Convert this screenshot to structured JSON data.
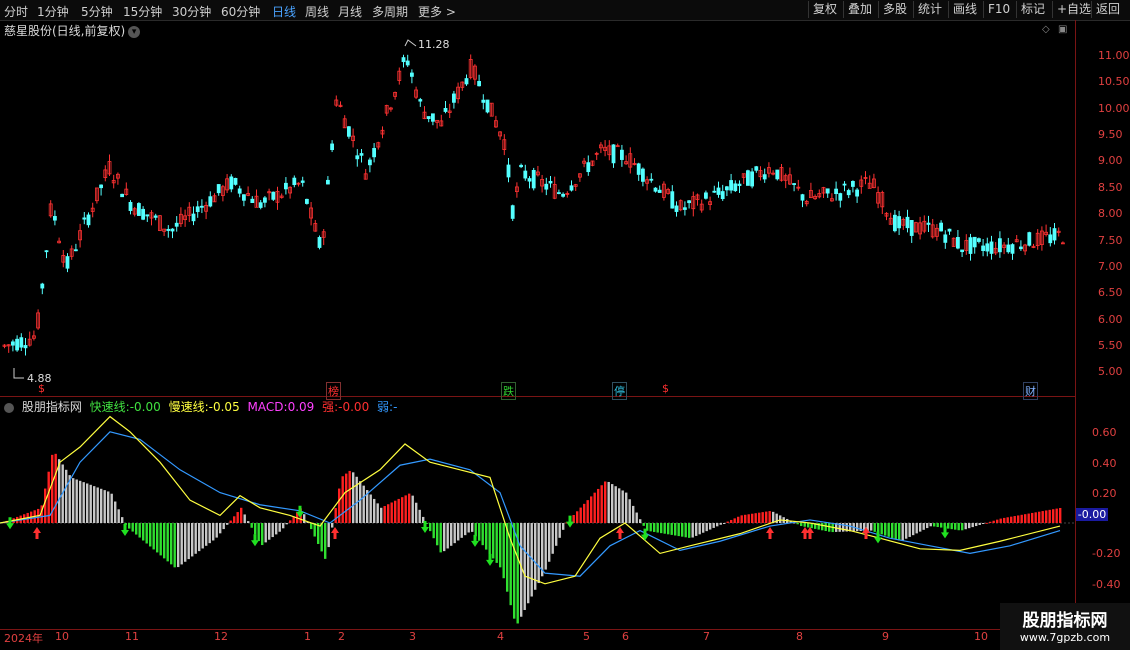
{
  "toolbar": {
    "timeframes": [
      "分时",
      "1分钟",
      "5分钟",
      "15分钟",
      "30分钟",
      "60分钟",
      "日线",
      "周线",
      "月线",
      "多周期",
      "更多 >"
    ],
    "active_timeframe": "日线",
    "right_buttons": [
      "复权",
      "叠加",
      "多股",
      "统计",
      "画线",
      "F10",
      "标记",
      "+自选",
      "返回"
    ]
  },
  "chart_header": {
    "title": "慈星股份(日线,前复权)"
  },
  "price_axis": [
    "11.00",
    "10.50",
    "10.00",
    "9.50",
    "9.00",
    "8.50",
    "8.00",
    "7.50",
    "7.00",
    "6.50",
    "6.00",
    "5.50",
    "5.00"
  ],
  "price_annotations": {
    "high": "11.28",
    "low": "4.88"
  },
  "event_markers": [
    {
      "label": "$",
      "color": "#ff3030"
    },
    {
      "label": "榜",
      "color": "#ff3030"
    },
    {
      "label": "跌",
      "color": "#30d030"
    },
    {
      "label": "停",
      "color": "#30c0e0"
    },
    {
      "label": "$",
      "color": "#ff3030"
    },
    {
      "label": "财",
      "color": "#80b0ff"
    }
  ],
  "indicator": {
    "name": "股朋指标网",
    "fast_label": "快速线:",
    "fast_value": "-0.00",
    "slow_label": "慢速线:",
    "slow_value": "-0.05",
    "macd_label": "MACD:",
    "macd_value": "0.09",
    "strong_label": "强:",
    "strong_value": "-0.00",
    "weak_label": "弱:",
    "weak_value": "-",
    "axis": [
      "0.60",
      "0.40",
      "0.20",
      "-0.20",
      "-0.40"
    ],
    "current_value": "-0.00",
    "colors": {
      "fast": "#ffff40",
      "slow": "#3399ff",
      "macd": "#ff40ff",
      "strong": "#ff3030",
      "weak": "#3399ff"
    }
  },
  "date_axis": [
    "2024年",
    "10",
    "11",
    "12",
    "1",
    "2",
    "3",
    "4",
    "5",
    "6",
    "7",
    "8",
    "9",
    "10"
  ],
  "watermark": {
    "title": "股朋指标网",
    "url": "www.7gpzb.com"
  }
}
